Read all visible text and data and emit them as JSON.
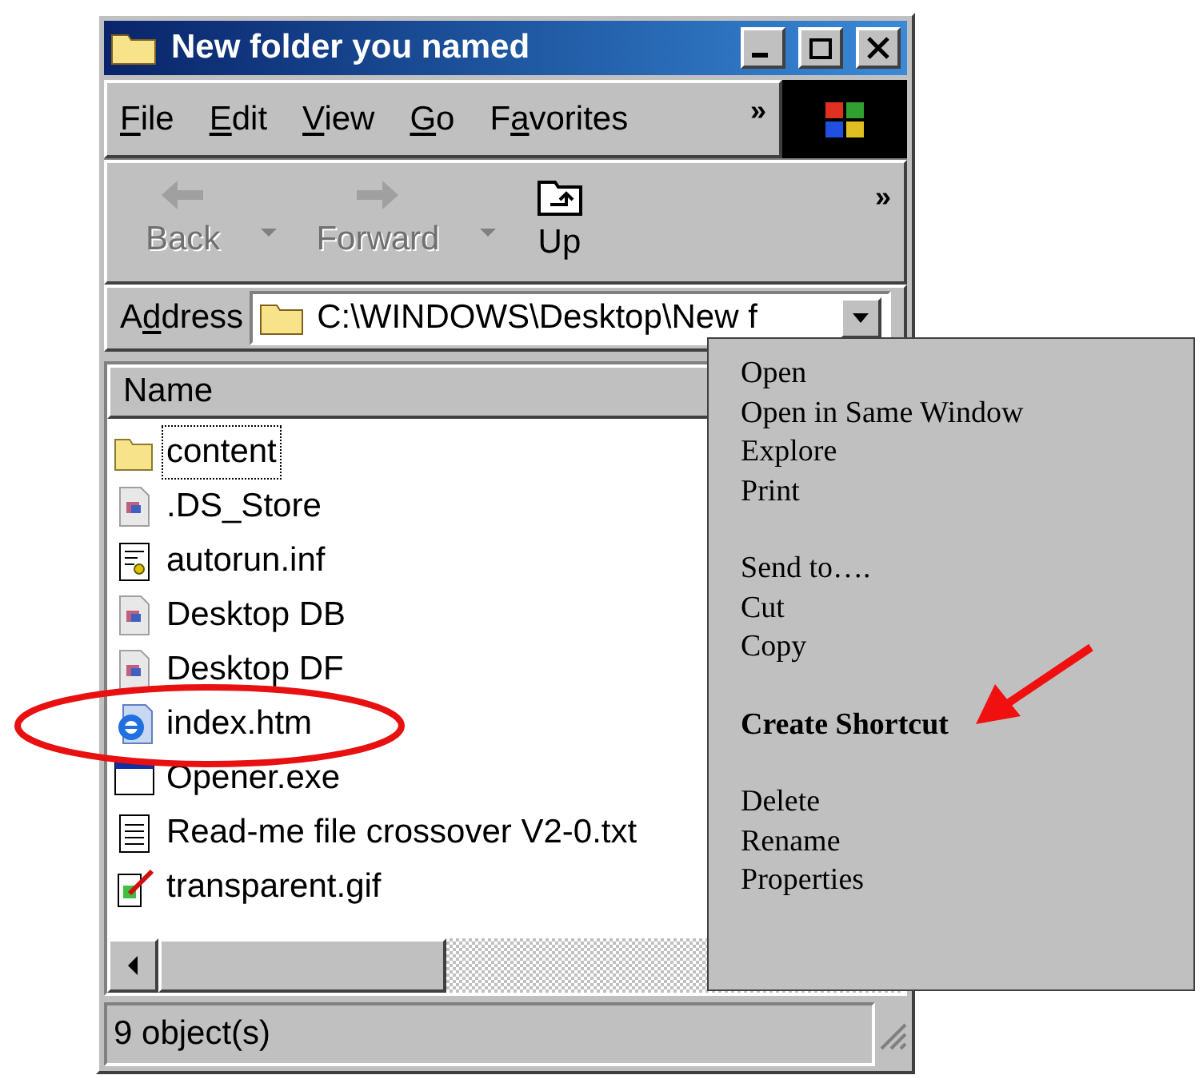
{
  "window": {
    "title": "New folder you named"
  },
  "menu_bar": [
    {
      "key": "F",
      "after": "ile"
    },
    {
      "key": "E",
      "after": "dit"
    },
    {
      "key": "V",
      "after": "iew"
    },
    {
      "key": "G",
      "after": "o"
    },
    {
      "before": "F",
      "key": "a",
      "after": "vorites"
    }
  ],
  "menu_overflow": "»",
  "toolbar": [
    {
      "kind": "back",
      "label": "Back",
      "disabled": true,
      "dropdown": true
    },
    {
      "kind": "forward",
      "label": "Forward",
      "disabled": true,
      "dropdown": true
    },
    {
      "kind": "up",
      "label": "Up",
      "disabled": false,
      "dropdown": false
    }
  ],
  "toolbar_overflow": "»",
  "address": {
    "label": {
      "before": "A",
      "key": "d",
      "after": "dress"
    },
    "value": "C:\\WINDOWS\\Desktop\\New f"
  },
  "file_list": {
    "columns": [
      "Name"
    ],
    "rows": [
      {
        "name": "content",
        "kind": "folder",
        "focused": true
      },
      {
        "name": ".DS_Store",
        "kind": "generic",
        "focused": false
      },
      {
        "name": "autorun.inf",
        "kind": "settings",
        "focused": false
      },
      {
        "name": "Desktop DB",
        "kind": "generic",
        "focused": false
      },
      {
        "name": "Desktop DF",
        "kind": "generic",
        "focused": false
      },
      {
        "name": "index.htm",
        "kind": "web",
        "focused": false
      },
      {
        "name": "Opener.exe",
        "kind": "program",
        "focused": false
      },
      {
        "name": "Read-me file crossover V2-0.txt",
        "kind": "text",
        "focused": false
      },
      {
        "name": "transparent.gif",
        "kind": "image",
        "focused": false
      }
    ]
  },
  "status_bar": "9 object(s)",
  "context_menu": [
    [
      {
        "label": "Open",
        "default": false
      },
      {
        "label": "Open in Same Window",
        "default": false
      },
      {
        "label": "Explore",
        "default": false
      },
      {
        "label": "Print",
        "default": false
      }
    ],
    [
      {
        "label": "Send to….",
        "default": false
      },
      {
        "label": "Cut",
        "default": false
      },
      {
        "label": "Copy",
        "default": false
      }
    ],
    [
      {
        "label": "Create Shortcut",
        "default": true
      }
    ],
    [
      {
        "label": "Delete",
        "default": false
      },
      {
        "label": "Rename",
        "default": false
      },
      {
        "label": "Properties",
        "default": false
      }
    ]
  ]
}
